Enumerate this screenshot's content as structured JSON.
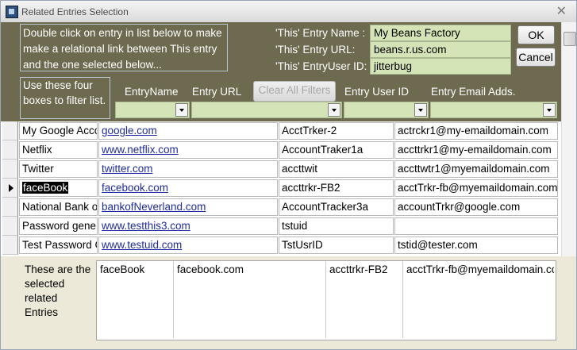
{
  "window": {
    "title": "Related Entries Selection",
    "close_glyph": "✕"
  },
  "header": {
    "instructions": "Double click on entry in list below to make make a relational link between This entry and the one selected below...",
    "filter_hint": "Use these four boxes to filter list.",
    "this_entry_name_label": "'This' Entry Name :",
    "this_entry_url_label": "'This' Entry URL:",
    "this_entry_userid_label": "'This' EntryUser ID:",
    "this_entry_name": "My Beans Factory",
    "this_entry_url": "beans.r.us.com",
    "this_entry_userid": "jitterbug",
    "ok_label": "OK",
    "cancel_label": "Cancel",
    "clear_filters_label": "Clear All Filters",
    "columns": [
      "EntryName",
      "Entry URL",
      "Entry User ID",
      "Entry Email Adds."
    ]
  },
  "rows": [
    {
      "name": "My Google Acco",
      "url": "google.com",
      "userid": "AcctTrker-2",
      "email": "actrckr1@my-emaildomain.com"
    },
    {
      "name": "Netflix",
      "url": "www.netflix.com",
      "userid": "AccountTraker1a",
      "email": "accttrkr1@my-emaildomain.com"
    },
    {
      "name": "Twitter",
      "url": "twitter.com",
      "userid": "accttwit",
      "email": "accttwtr1@myemaildomain.com"
    },
    {
      "name": "faceBook",
      "url": "facebook.com",
      "userid": "accttrkr-FB2",
      "email": "acctTrkr-fb@myemaildomain.com"
    },
    {
      "name": "National Bank o",
      "url": "bankofNeverland.com",
      "userid": "AccountTracker3a",
      "email": "accountTrkr@google.com"
    },
    {
      "name": "Password gene",
      "url": "www.testthis3.com",
      "userid": "tstuid",
      "email": ""
    },
    {
      "name": "Test Password G",
      "url": "www.testuid.com",
      "userid": "TstUsrID",
      "email": "tstid@tester.com"
    }
  ],
  "current_row": 3,
  "footer": {
    "label": "These are the selected related Entries",
    "selected": {
      "name": "faceBook",
      "url": "facebook.com",
      "userid": "accttrkr-FB2",
      "email": "acctTrkr-fb@myemaildomain.com"
    }
  },
  "colors": {
    "header_bg": "#6d6a4f",
    "field_bg": "#d5e4b6",
    "link": "#1e2ca0"
  }
}
